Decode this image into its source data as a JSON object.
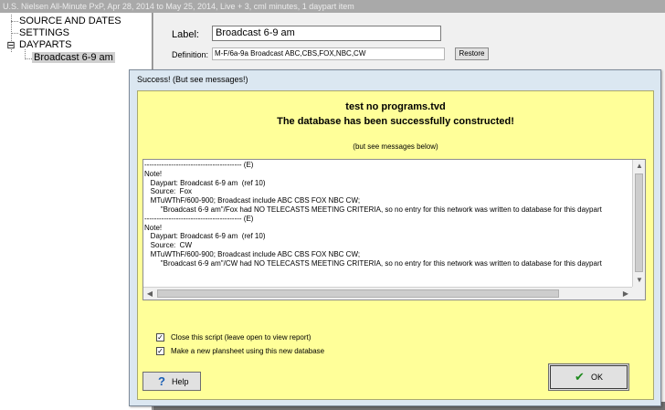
{
  "app": {
    "title": "U.S. Nielsen All-Minute PxP, Apr 28, 2014 to May 25, 2014, Live + 3, cml minutes, 1 daypart item"
  },
  "tree": {
    "items": [
      {
        "label": "SOURCE AND DATES"
      },
      {
        "label": "SETTINGS"
      },
      {
        "label": "DAYPARTS",
        "expander": "⊟"
      },
      {
        "label": "Broadcast 6-9 am"
      }
    ]
  },
  "editor": {
    "label_caption": "Label:",
    "label_value": "Broadcast 6-9 am",
    "definition_caption": "Definition:",
    "definition_value": "M-F/6a-9a Broadcast ABC,CBS,FOX,NBC,CW",
    "restore_label": "Restore"
  },
  "dialog": {
    "title": "Success! (But see messages!)",
    "heading1": "test no programs.tvd",
    "heading2": "The database has been successfully constructed!",
    "subnote": "(but see messages below)",
    "log_lines": [
      "---------------------------------------- (E)",
      "Note!",
      "   Daypart: Broadcast 6-9 am  (ref 10)",
      "   Source:  Fox",
      "   MTuWThF/600-900; Broadcast include ABC CBS FOX NBC CW;",
      "        \"Broadcast 6-9 am\"/Fox had NO TELECASTS MEETING CRITERIA, so no entry for this network was written to database for this daypart",
      "---------------------------------------- (E)",
      "Note!",
      "   Daypart: Broadcast 6-9 am  (ref 10)",
      "   Source:  CW",
      "   MTuWThF/600-900; Broadcast include ABC CBS FOX NBC CW;",
      "        \"Broadcast 6-9 am\"/CW had NO TELECASTS MEETING CRITERIA, so no entry for this network was written to database for this daypart"
    ],
    "checkbox1_label": "Close this script   (leave open to view report)",
    "checkbox2_label": "Make a new plansheet using this new database",
    "help_label": "Help",
    "ok_label": "OK",
    "check_glyph": "✓",
    "help_glyph": "?",
    "ok_glyph": "✔",
    "scroll_up": "▲",
    "scroll_down": "▼",
    "scroll_left": "◀",
    "scroll_right": "▶"
  }
}
